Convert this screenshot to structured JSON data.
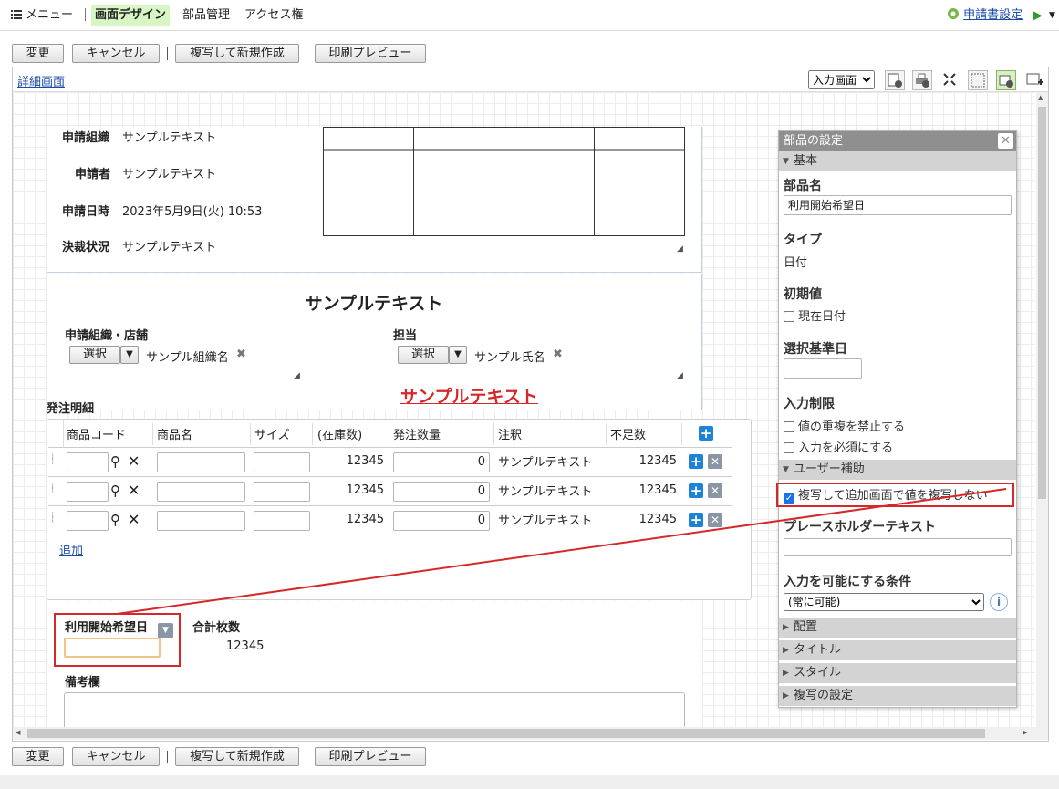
{
  "topnav": {
    "menu": "メニュー",
    "design": "画面デザイン",
    "parts": "部品管理",
    "access": "アクセス権",
    "app_settings": "申請書設定"
  },
  "toolbar": {
    "change": "変更",
    "cancel": "キャンセル",
    "copy_new": "複写して新規作成",
    "print_preview": "印刷プレビュー"
  },
  "frame": {
    "detail_link": "詳細画面",
    "view_select": "入力画面"
  },
  "form": {
    "org_label": "申請組織",
    "org_value": "サンプルテキスト",
    "applicant_label": "申請者",
    "applicant_value": "サンプルテキスト",
    "date_label": "申請日時",
    "date_value": "2023年5月9日(火) 10:53",
    "status_label": "決裁状況",
    "status_value": "サンプルテキスト",
    "heading": "サンプルテキスト",
    "store_label": "申請組織・店舗",
    "select_btn": "選択",
    "org_name": "サンプル組織名",
    "person_label": "担当",
    "person_name": "サンプル氏名",
    "red_heading": "サンプルテキスト",
    "details_label": "発注明細",
    "table_headers": [
      "商品コード",
      "商品名",
      "サイズ",
      "(在庫数)",
      "発注数量",
      "注釈",
      "不足数"
    ],
    "rows": [
      {
        "stock": "12345",
        "qty": "0",
        "note": "サンプルテキスト",
        "shortage": "12345"
      },
      {
        "stock": "12345",
        "qty": "0",
        "note": "サンプルテキスト",
        "shortage": "12345"
      },
      {
        "stock": "12345",
        "qty": "0",
        "note": "サンプルテキスト",
        "shortage": "12345"
      }
    ],
    "add_link": "追加",
    "start_date_label": "利用開始希望日",
    "total_label": "合計枚数",
    "total_value": "12345",
    "remarks_label": "備考欄"
  },
  "panel": {
    "title": "部品の設定",
    "basic": "基本",
    "name_label": "部品名",
    "name_value": "利用開始希望日",
    "type_label": "タイプ",
    "type_value": "日付",
    "initial_label": "初期値",
    "current_date": "現在日付",
    "base_date_label": "選択基準日",
    "restrict_label": "入力制限",
    "no_duplicate": "値の重複を禁止する",
    "required": "入力を必須にする",
    "user_assist": "ユーザー補助",
    "no_copy": "複写して追加画面で値を複写しない",
    "placeholder_label": "プレースホルダーテキスト",
    "condition_label": "入力を可能にする条件",
    "condition_value": "(常に可能)",
    "layout": "配置",
    "title_section": "タイトル",
    "style": "スタイル",
    "copy_settings": "複写の設定"
  },
  "colors": {
    "active_tab": "#d8f5c4",
    "red": "#d62828",
    "blue": "#1e82d6"
  }
}
